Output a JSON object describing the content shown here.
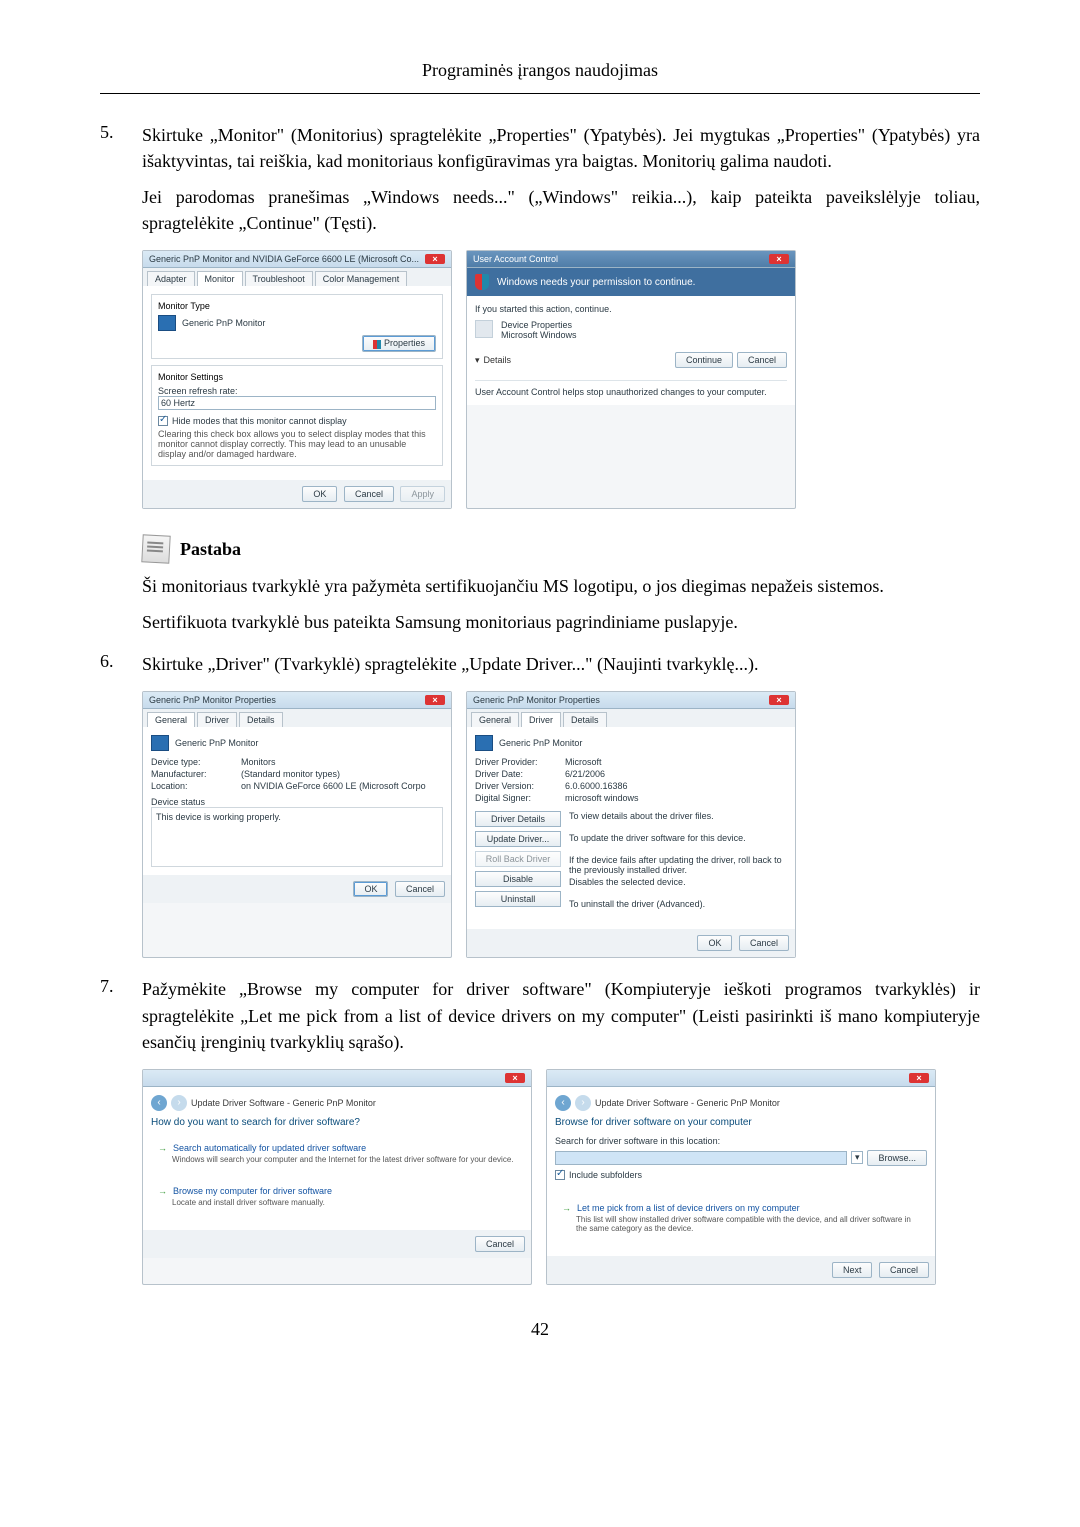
{
  "header": {
    "title": "Programinės įrangos naudojimas"
  },
  "step5": {
    "num": "5.",
    "p1": "Skirtuke „Monitor\" (Monitorius) spragtelėkite „Properties\" (Ypatybės). Jei mygtukas „Properties\" (Ypatybės) yra išaktyvintas, tai reiškia, kad monitoriaus konfigūravimas yra baigtas. Monitorių galima naudoti.",
    "p2": "Jei parodomas pranešimas „Windows needs...\" („Windows\" reikia...), kaip pateikta paveikslėlyje toliau, spragtelėkite „Continue\" (Tęsti)."
  },
  "fig5_left": {
    "title": "Generic PnP Monitor and NVIDIA GeForce 6600 LE (Microsoft Co...",
    "tabs": [
      "Adapter",
      "Monitor",
      "Troubleshoot",
      "Color Management"
    ],
    "monitorType": {
      "legend": "Monitor Type",
      "value": "Generic PnP Monitor",
      "propBtn": "Properties"
    },
    "monitorSettings": {
      "legend": "Monitor Settings",
      "refreshLabel": "Screen refresh rate:",
      "refreshValue": "60 Hertz",
      "hideLabel": "Hide modes that this monitor cannot display",
      "warn": "Clearing this check box allows you to select display modes that this monitor cannot display correctly. This may lead to an unusable display and/or damaged hardware."
    },
    "ok": "OK",
    "cancel": "Cancel",
    "apply": "Apply"
  },
  "fig5_right": {
    "title": "User Account Control",
    "banner": "Windows needs your permission to continue.",
    "started": "If you started this action, continue.",
    "item1": "Device Properties",
    "item2": "Microsoft Windows",
    "details": "Details",
    "continue": "Continue",
    "cancel": "Cancel",
    "foot": "User Account Control helps stop unauthorized changes to your computer."
  },
  "note": {
    "label": "Pastaba"
  },
  "after5": {
    "p1": "Ši monitoriaus tvarkyklė yra pažymėta sertifikuojančiu MS logotipu, o jos diegimas nepažeis sistemos.",
    "p2": "Sertifikuota tvarkyklė bus pateikta Samsung monitoriaus pagrindiniame puslapyje."
  },
  "step6": {
    "num": "6.",
    "p1": "Skirtuke „Driver\" (Tvarkyklė) spragtelėkite „Update Driver...\" (Naujinti tvarkyklę...)."
  },
  "fig6_left": {
    "title": "Generic PnP Monitor Properties",
    "tabs": [
      "General",
      "Driver",
      "Details"
    ],
    "device": "Generic PnP Monitor",
    "kv": [
      {
        "k": "Device type:",
        "v": "Monitors"
      },
      {
        "k": "Manufacturer:",
        "v": "(Standard monitor types)"
      },
      {
        "k": "Location:",
        "v": "on NVIDIA GeForce 6600 LE (Microsoft Corpo"
      }
    ],
    "statusLabel": "Device status",
    "status": "This device is working properly.",
    "ok": "OK",
    "cancel": "Cancel"
  },
  "fig6_right": {
    "title": "Generic PnP Monitor Properties",
    "tabs": [
      "General",
      "Driver",
      "Details"
    ],
    "device": "Generic PnP Monitor",
    "kv": [
      {
        "k": "Driver Provider:",
        "v": "Microsoft"
      },
      {
        "k": "Driver Date:",
        "v": "6/21/2006"
      },
      {
        "k": "Driver Version:",
        "v": "6.0.6000.16386"
      },
      {
        "k": "Digital Signer:",
        "v": "microsoft windows"
      }
    ],
    "btns": [
      {
        "b": "Driver Details",
        "d": "To view details about the driver files."
      },
      {
        "b": "Update Driver...",
        "d": "To update the driver software for this device."
      },
      {
        "b": "Roll Back Driver",
        "d": "If the device fails after updating the driver, roll back to the previously installed driver."
      },
      {
        "b": "Disable",
        "d": "Disables the selected device."
      },
      {
        "b": "Uninstall",
        "d": "To uninstall the driver (Advanced)."
      }
    ],
    "ok": "OK",
    "cancel": "Cancel"
  },
  "step7": {
    "num": "7.",
    "p1": "Pažymėkite „Browse my computer for driver software\" (Kompiuteryje ieškoti programos tvarkyklės) ir spragtelėkite „Let me pick from a list of device drivers on my computer\" (Leisti pasirinkti iš mano kompiuteryje esančių įrenginių tvarkyklių sąrašo)."
  },
  "fig7_left": {
    "crumb": "Update Driver Software - Generic PnP Monitor",
    "title": "How do you want to search for driver software?",
    "opt1": {
      "t": "Search automatically for updated driver software",
      "d": "Windows will search your computer and the Internet for the latest driver software for your device."
    },
    "opt2": {
      "t": "Browse my computer for driver software",
      "d": "Locate and install driver software manually."
    },
    "cancel": "Cancel"
  },
  "fig7_right": {
    "crumb": "Update Driver Software - Generic PnP Monitor",
    "title": "Browse for driver software on your computer",
    "searchLabel": "Search for driver software in this location:",
    "browse": "Browse...",
    "include": "Include subfolders",
    "opt": {
      "t": "Let me pick from a list of device drivers on my computer",
      "d": "This list will show installed driver software compatible with the device, and all driver software in the same category as the device."
    },
    "next": "Next",
    "cancel": "Cancel"
  },
  "pageNum": "42"
}
